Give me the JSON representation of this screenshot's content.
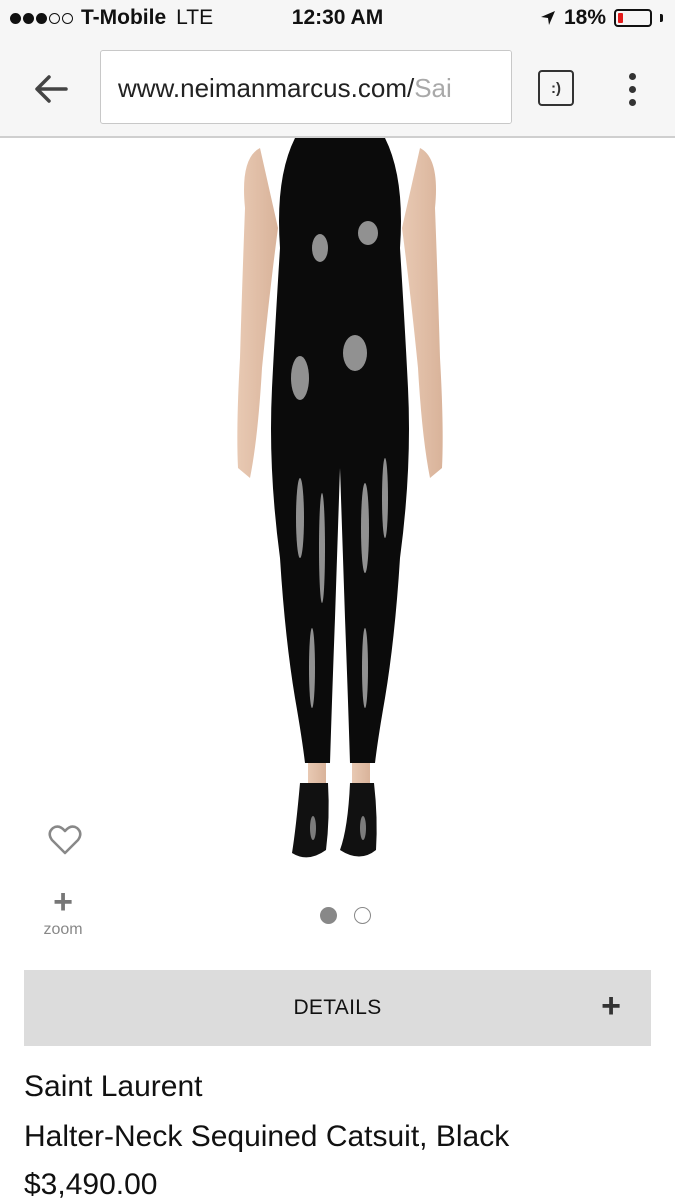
{
  "status_bar": {
    "signal_filled": 3,
    "signal_empty": 2,
    "carrier": "T-Mobile",
    "network": "LTE",
    "time": "12:30 AM",
    "battery_percent": "18%",
    "battery_level": 0.18,
    "battery_color": "#e41b1b",
    "location_icon": "location-arrow-icon"
  },
  "browser": {
    "url_host": "www.neimanmarcus.com/",
    "url_path": "Sai",
    "reader_icon": "reader-mode-icon",
    "reader_glyph": ":)",
    "back_icon": "back-arrow-icon",
    "menu_icon": "more-vert-icon"
  },
  "product": {
    "favorite_icon": "heart-icon",
    "zoom_icon": "plus-icon",
    "zoom_label": "zoom",
    "carousel_count": 2,
    "carousel_active_index": 0,
    "details_label": "DETAILS",
    "details_icon": "plus-icon",
    "brand": "Saint Laurent",
    "name": "Halter-Neck Sequined Catsuit, Black",
    "price": "$3,490.00"
  }
}
